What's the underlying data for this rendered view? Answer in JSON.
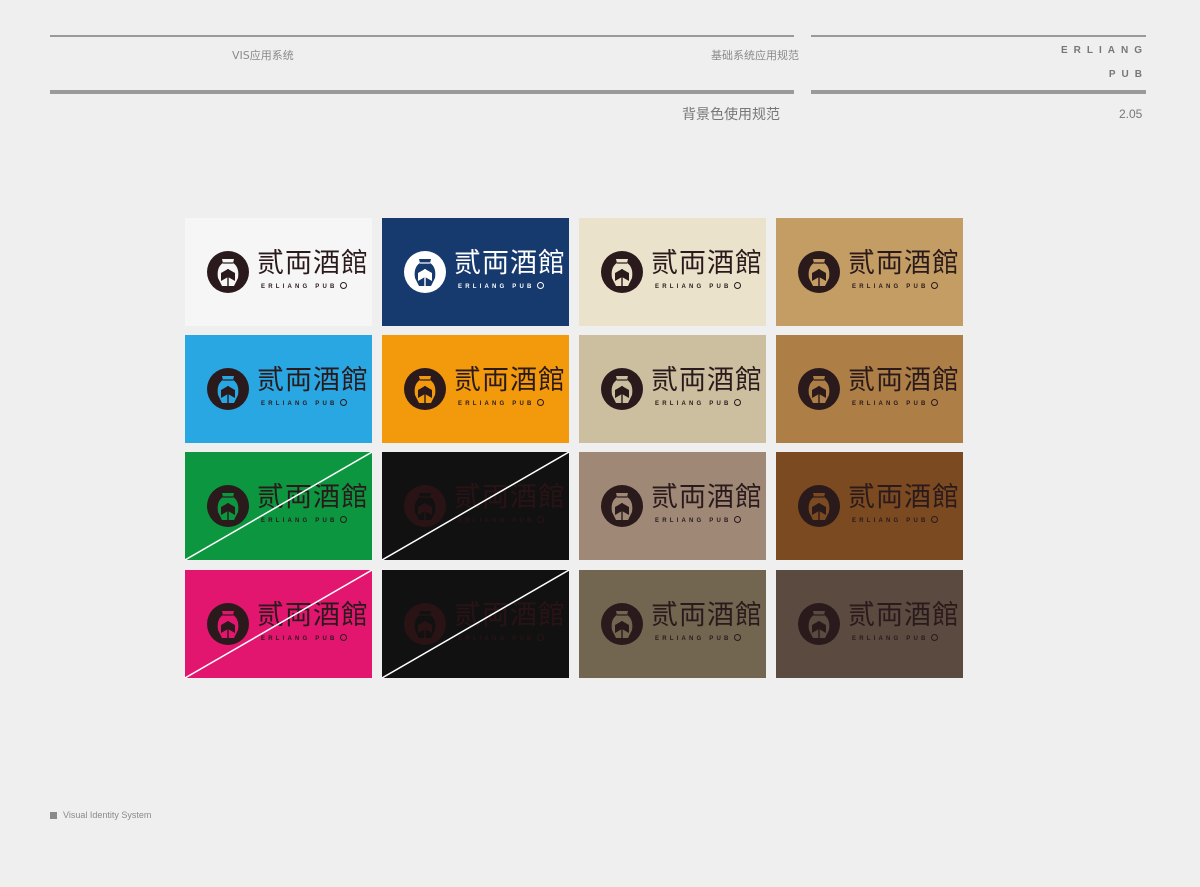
{
  "header": {
    "left_label": "VIS应用系统",
    "right_label": "基础系统应用规范",
    "brand_line1": "ERLIANG",
    "brand_line2": "PUB",
    "section_title": "背景色使用规范",
    "page_number": "2.05"
  },
  "logo": {
    "wordmark": "贰両酒館",
    "tagline": "ERLIANG PUB"
  },
  "cards": [
    {
      "bg": "#f6f6f6",
      "logo_color": "#2a1a1c",
      "mark_inner": "#f6f6f6",
      "crossed": false
    },
    {
      "bg": "#163a6e",
      "logo_color": "#ffffff",
      "mark_inner": "#163a6e",
      "crossed": false
    },
    {
      "bg": "#ebe2cb",
      "logo_color": "#2a1a1c",
      "mark_inner": "#ebe2cb",
      "crossed": false
    },
    {
      "bg": "#c49d64",
      "logo_color": "#2a1a1c",
      "mark_inner": "#c49d64",
      "crossed": false
    },
    {
      "bg": "#29a7e3",
      "logo_color": "#2a1a1c",
      "mark_inner": "#29a7e3",
      "crossed": false
    },
    {
      "bg": "#f39a0c",
      "logo_color": "#2a1a1c",
      "mark_inner": "#f39a0c",
      "crossed": false
    },
    {
      "bg": "#cbbfa0",
      "logo_color": "#2a1a1c",
      "mark_inner": "#cbbfa0",
      "crossed": false
    },
    {
      "bg": "#ad7e46",
      "logo_color": "#2a1a1c",
      "mark_inner": "#ad7e46",
      "crossed": false
    },
    {
      "bg": "#0c963f",
      "logo_color": "#2a1a1c",
      "mark_inner": "#0c963f",
      "crossed": true
    },
    {
      "bg": "#111111",
      "logo_color": "#2a1315",
      "mark_inner": "#111111",
      "crossed": true
    },
    {
      "bg": "#a08877",
      "logo_color": "#2a1a1c",
      "mark_inner": "#a08877",
      "crossed": false
    },
    {
      "bg": "#7b4a21",
      "logo_color": "#2a1a1c",
      "mark_inner": "#7b4a21",
      "crossed": false
    },
    {
      "bg": "#e3166f",
      "logo_color": "#2a1a1c",
      "mark_inner": "#e3166f",
      "crossed": true
    },
    {
      "bg": "#111111",
      "logo_color": "#2a1315",
      "mark_inner": "#111111",
      "crossed": true
    },
    {
      "bg": "#726651",
      "logo_color": "#2a1a1c",
      "mark_inner": "#726651",
      "crossed": false
    },
    {
      "bg": "#5a4a40",
      "logo_color": "#2a1a1c",
      "mark_inner": "#5a4a40",
      "crossed": false
    }
  ],
  "footer": {
    "label": "Visual Identity System"
  }
}
